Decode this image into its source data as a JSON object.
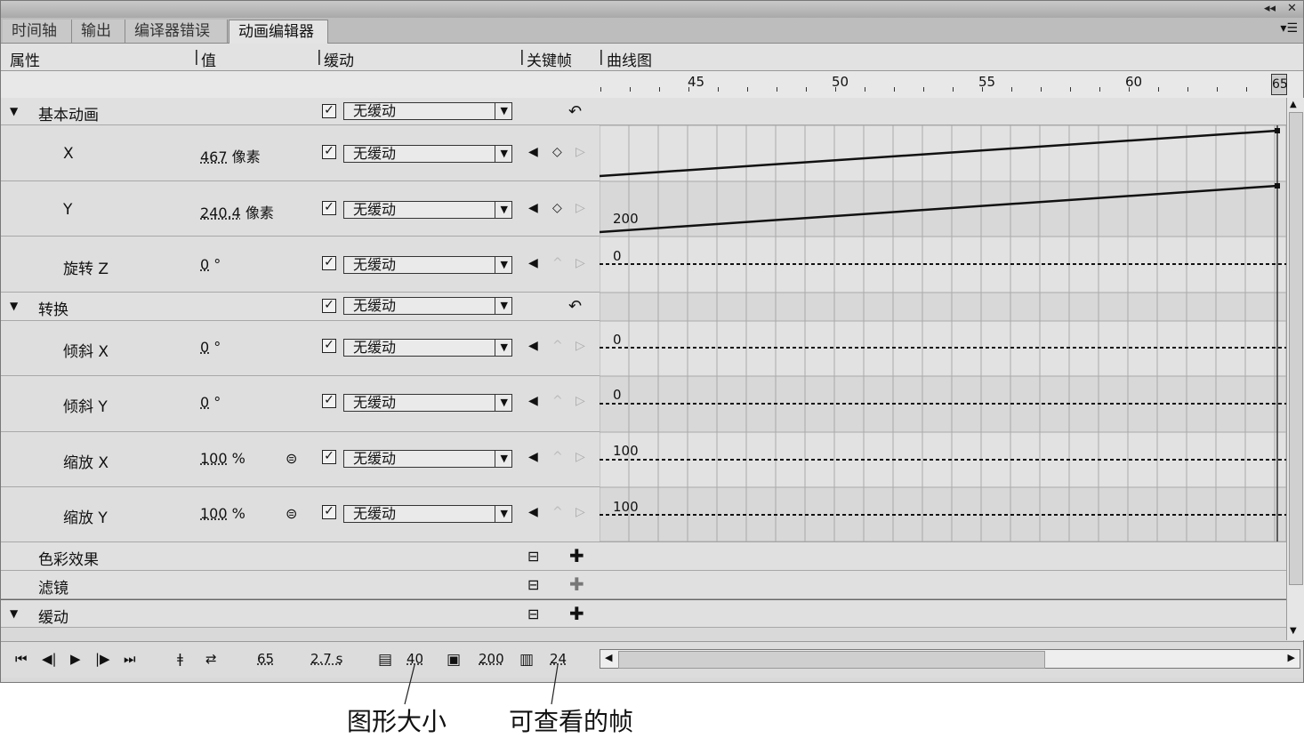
{
  "window": {
    "collapse_icon": "◂◂",
    "close_icon": "✕"
  },
  "tabs": [
    {
      "label": "时间轴",
      "active": false
    },
    {
      "label": "输出",
      "active": false
    },
    {
      "label": "编译器错误",
      "active": false
    },
    {
      "label": "动画编辑器",
      "active": true
    }
  ],
  "columns": {
    "property": "属性",
    "value": "值",
    "easing": "缓动",
    "keyframe": "关键帧",
    "graph": "曲线图"
  },
  "ruler": {
    "labels": [
      "45",
      "50",
      "55",
      "60"
    ],
    "current_frame": "65"
  },
  "sections": {
    "basic_motion": {
      "label": "基本动画",
      "ease": "无缓动"
    },
    "transform": {
      "label": "转换",
      "ease": "无缓动"
    },
    "color_effect": {
      "label": "色彩效果"
    },
    "filters": {
      "label": "滤镜"
    },
    "easing": {
      "label": "缓动"
    }
  },
  "properties": {
    "x": {
      "label": "X",
      "value": "467",
      "unit": "像素",
      "ease": "无缓动"
    },
    "y": {
      "label": "Y",
      "value": "240.4",
      "unit": "像素",
      "ease": "无缓动",
      "graph_label": "200"
    },
    "rotate_z": {
      "label": "旋转 Z",
      "value": "0",
      "unit": "°",
      "ease": "无缓动",
      "graph_label": "0"
    },
    "skew_x": {
      "label": "倾斜 X",
      "value": "0",
      "unit": "°",
      "ease": "无缓动",
      "graph_label": "0"
    },
    "skew_y": {
      "label": "倾斜 Y",
      "value": "0",
      "unit": "°",
      "ease": "无缓动",
      "graph_label": "0"
    },
    "scale_x": {
      "label": "缩放 X",
      "value": "100",
      "unit": "%",
      "ease": "无缓动",
      "graph_label": "100"
    },
    "scale_y": {
      "label": "缩放 Y",
      "value": "100",
      "unit": "%",
      "ease": "无缓动",
      "graph_label": "100"
    }
  },
  "bottom": {
    "current_frame": "65",
    "time": "2.7 s",
    "graph_size": "40",
    "expanded_graph_size": "200",
    "viewable_frames": "24"
  },
  "captions": {
    "graph_size": "图形大小",
    "viewable_frames": "可查看的帧"
  }
}
